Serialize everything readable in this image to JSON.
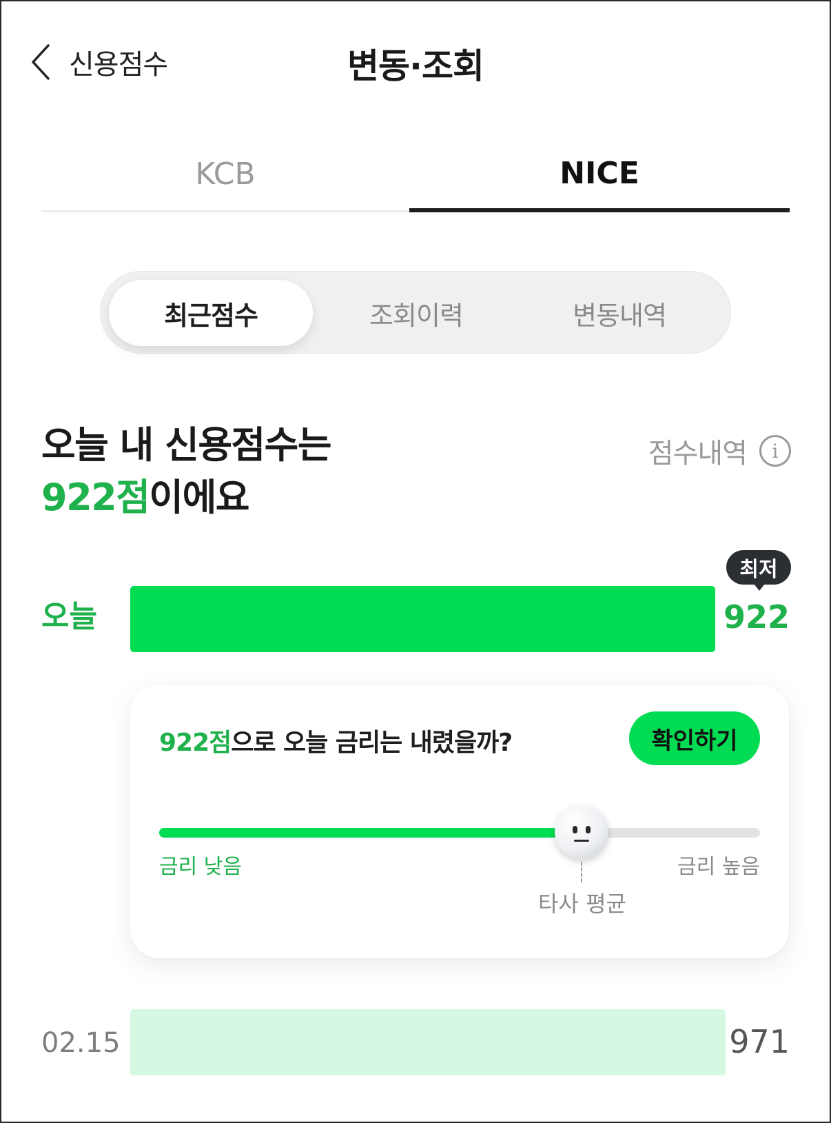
{
  "header": {
    "back_label": "신용점수",
    "title": "변동·조회"
  },
  "bureau_tabs": [
    {
      "label": "KCB",
      "active": false
    },
    {
      "label": "NICE",
      "active": true
    }
  ],
  "segment_tabs": [
    {
      "label": "최근점수",
      "active": true
    },
    {
      "label": "조회이력",
      "active": false
    },
    {
      "label": "변동내역",
      "active": false
    }
  ],
  "headline": {
    "line1": "오늘 내 신용점수는",
    "score_text": "922점",
    "suffix": "이에요"
  },
  "history_link": {
    "label": "점수내역",
    "icon": "info-icon"
  },
  "today": {
    "label": "오늘",
    "score": "922",
    "badge": "최저"
  },
  "rate_card": {
    "question_score": "922점",
    "question_rest": "으로 오늘 금리는 내렸을까?",
    "button_label": "확인하기",
    "low_label": "금리 낮음",
    "high_label": "금리 높음",
    "average_label": "타사 평균",
    "slider_position": 0.7,
    "thumb_icon": "neutral-face-icon"
  },
  "history": [
    {
      "date": "02.15",
      "score": "971"
    }
  ],
  "colors": {
    "accent_green": "#02dc52",
    "text_green": "#1fb14b",
    "past_bar": "#d4f8e2"
  }
}
